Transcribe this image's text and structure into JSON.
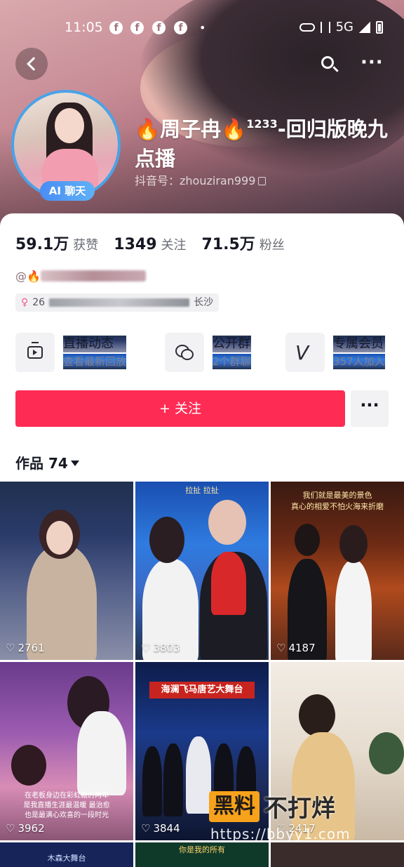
{
  "status_bar": {
    "time": "11:05",
    "network": "5G"
  },
  "header": {
    "name_prefix_emoji": "🔥",
    "name_main": "周子冉",
    "name_suffix_emoji": "🔥",
    "name_sup": "1233",
    "name_rest": "-回归版晚九点播",
    "douyin_id": "抖音号：zhouziran999",
    "ai_badge": "AI 聊天"
  },
  "stats": [
    {
      "value": "59.1万",
      "label": "获赞"
    },
    {
      "value": "1349",
      "label": "关注"
    },
    {
      "value": "71.5万",
      "label": "粉丝"
    }
  ],
  "bio": {
    "line1_prefix": "@🔥",
    "tag_prefix": "26",
    "tag_suffix": "长沙"
  },
  "features": [
    {
      "title": "直播动态",
      "subtitle": "查看最新回放",
      "icon": "tv-icon"
    },
    {
      "title": "公开群",
      "subtitle": "2个群聊",
      "icon": "chat-bubbles-icon"
    },
    {
      "title": "专属会员",
      "subtitle": "357人加入",
      "icon": "v-member-icon"
    }
  ],
  "actions": {
    "follow": "+ 关注",
    "more": "···"
  },
  "works": {
    "label": "作品 74"
  },
  "videos": [
    {
      "likes": "2761"
    },
    {
      "likes": "3803",
      "caption": "拉扯 拉扯"
    },
    {
      "likes": "4187",
      "caption": "我们就是最美的景色\n真心的相爱不怕火海来折磨"
    },
    {
      "likes": "3962",
      "caption": "在老板身边在彩虹糖的两年\n是我直播生涯最温暖 最治愈\n也是最满心欢喜的一段时光"
    },
    {
      "likes": "3844",
      "caption": "海澜飞马唐艺大舞台"
    },
    {
      "likes": "2417"
    },
    {
      "caption": "木森大舞台"
    },
    {
      "caption": "你是我的所有"
    },
    {
      "caption": ""
    }
  ],
  "watermark": {
    "box": "黑料",
    "text": "不打烊",
    "url": "https://bbyy1.com"
  }
}
